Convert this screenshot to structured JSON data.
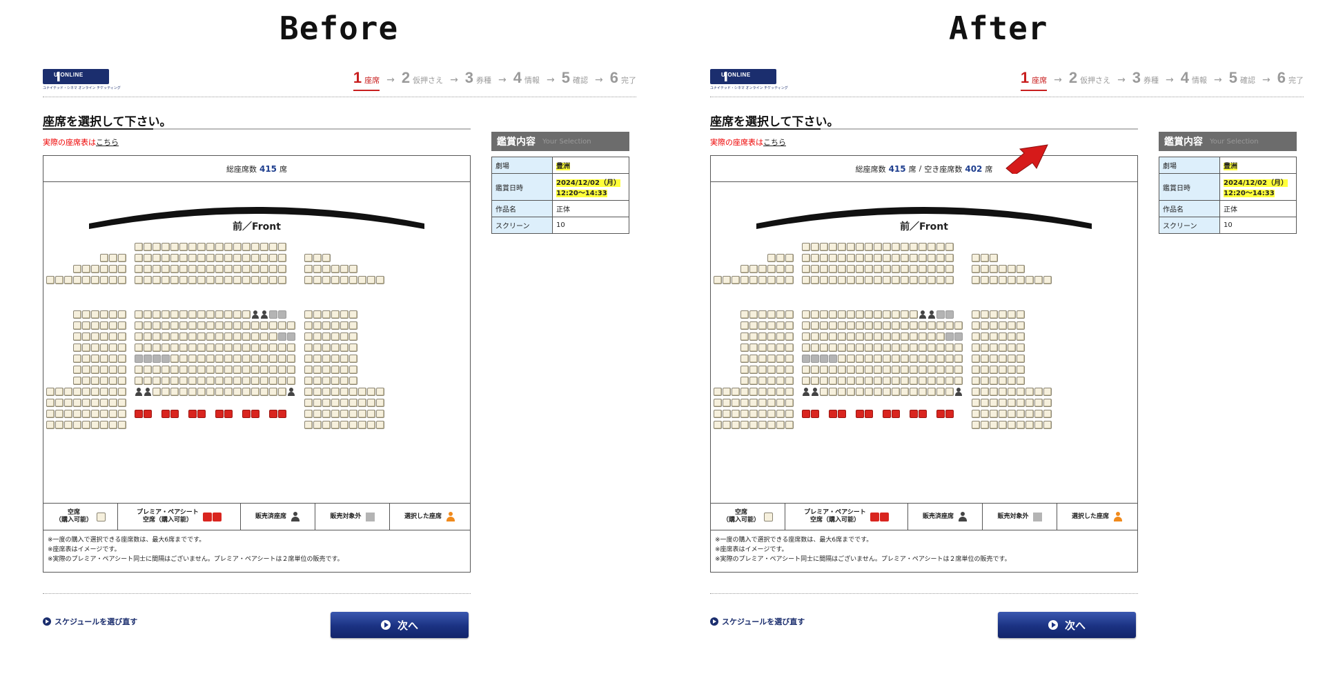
{
  "headings": {
    "before": "Before",
    "after": "After"
  },
  "logo": {
    "text": "U-ONLINE",
    "tagline": "ユナイテッド・シネマ オンライン チケッティング"
  },
  "steps": [
    {
      "num": "1",
      "label": "座席"
    },
    {
      "num": "2",
      "label": "仮押さえ"
    },
    {
      "num": "3",
      "label": "券種"
    },
    {
      "num": "4",
      "label": "情報"
    },
    {
      "num": "5",
      "label": "確認"
    },
    {
      "num": "6",
      "label": "完了"
    }
  ],
  "step_arrow": "→",
  "page_title": "座席を選択して下さい。",
  "actual_link": {
    "prefix": "実際の座席表は",
    "link": "こちら"
  },
  "before": {
    "total_label": "総座席数",
    "total": "415",
    "unit": "席"
  },
  "after": {
    "total_label": "総座席数",
    "total": "415",
    "unit": "席",
    "sep": "/",
    "vacant_label": "空き座席数",
    "vacant": "402",
    "vacant_unit": "席"
  },
  "front_label": "前／Front",
  "legend": {
    "empty_top": "空席",
    "empty_bottom": "（購入可能）",
    "premium_top": "プレミア・ペアシート",
    "premium_bottom": "空席（購入可能）",
    "sold": "販売済座席",
    "blocked": "販売対象外",
    "selected": "選択した座席"
  },
  "notes": [
    "※一度の購入で選択できる座席数は、最大6席までです。",
    "※座席表はイメージです。",
    "※実際のプレミア・ペアシート同士に間隔はございません。プレミア・ペアシートは２席単位の販売です。"
  ],
  "sidebar": {
    "title": "鑑賞内容",
    "title_en": "Your Selection",
    "rows": [
      {
        "key": "劇場",
        "value": "豊洲",
        "highlight": true
      },
      {
        "key": "鑑賞日時",
        "value": "2024/12/02（月）",
        "value2": "12:20～14:33",
        "highlight": true
      },
      {
        "key": "作品名",
        "value": "正体",
        "highlight": false
      },
      {
        "key": "スクリーン",
        "value": "10",
        "highlight": false
      }
    ]
  },
  "back_link": "スケジュールを選び直す",
  "next_button": "次へ",
  "colors": {
    "brand": "#1b2e6e",
    "accent": "#c81e1e",
    "premium": "#d9251f",
    "highlight": "#ffff3a",
    "arrow": "#d61a1a"
  }
}
